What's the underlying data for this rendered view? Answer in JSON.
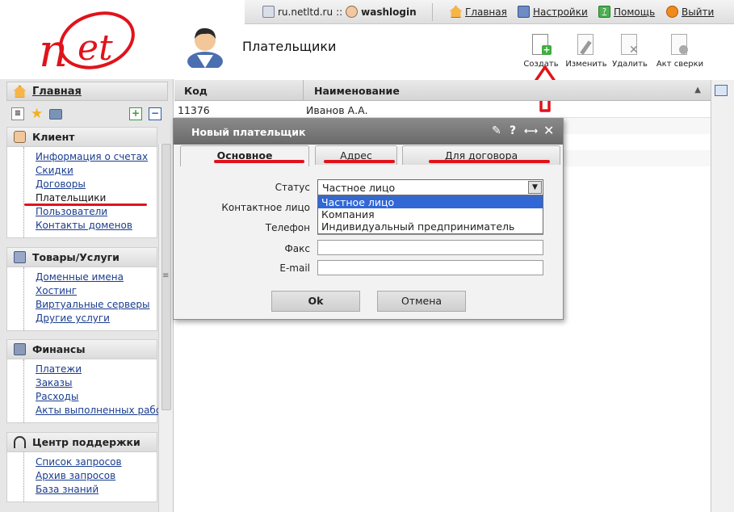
{
  "topbar": {
    "site": "ru.netltd.ru",
    "sep": "::",
    "user": "washlogin",
    "home": "Главная",
    "settings": "Настройки",
    "help": "Помощь",
    "logout": "Выйти"
  },
  "header": {
    "title": "Плательщики"
  },
  "toolbar": {
    "create": "Создать",
    "edit": "Изменить",
    "delete": "Удалить",
    "act": "Акт сверки"
  },
  "sidebar": {
    "home": "Главная",
    "sections": [
      {
        "title": "Клиент",
        "items": [
          "Информация о счетах",
          "Скидки",
          "Договоры",
          "Плательщики",
          "Пользователи",
          "Контакты доменов"
        ]
      },
      {
        "title": "Товары/Услуги",
        "items": [
          "Доменные имена",
          "Хостинг",
          "Виртуальные серверы",
          "Другие услуги"
        ]
      },
      {
        "title": "Финансы",
        "items": [
          "Платежи",
          "Заказы",
          "Расходы",
          "Акты выполненных работ"
        ]
      },
      {
        "title": "Центр поддержки",
        "items": [
          "Список запросов",
          "Архив запросов",
          "База знаний"
        ]
      }
    ]
  },
  "grid": {
    "columns": [
      "Код",
      "Наименование"
    ],
    "rows": [
      [
        "11376",
        "Иванов А.А."
      ]
    ]
  },
  "dialog": {
    "title": "Новый плательщик",
    "tabs": [
      "Основное",
      "Адрес",
      "Для договора"
    ],
    "fields": {
      "status_label": "Статус",
      "status_value": "Частное лицо",
      "contact_label": "Контактное лицо",
      "phone_label": "Телефон",
      "fax_label": "Факс",
      "email_label": "E-mail"
    },
    "status_options": [
      "Частное лицо",
      "Компания",
      "Индивидуальный предприниматель"
    ],
    "ok": "Ok",
    "cancel": "Отмена"
  },
  "colors": {
    "accent_red": "#e0131b",
    "selection_blue": "#3267d6",
    "dialog_title": "#777777"
  }
}
